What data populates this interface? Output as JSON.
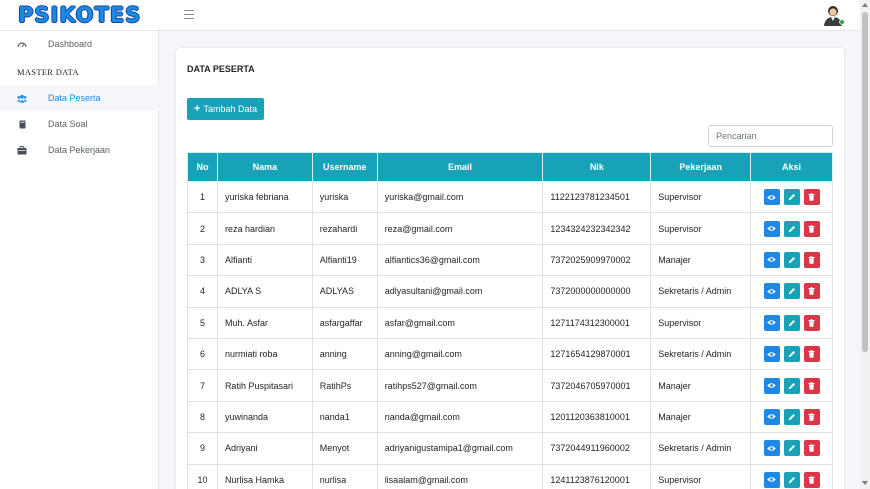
{
  "brand": "PSIKOTES",
  "sidebar": {
    "dashboard": "Dashboard",
    "section_header": "MASTER DATA",
    "items": [
      {
        "label": "Data Peserta",
        "icon": "users-icon",
        "active": true
      },
      {
        "label": "Data Soal",
        "icon": "book-icon",
        "active": false
      },
      {
        "label": "Data Pekerjaan",
        "icon": "briefcase-icon",
        "active": false
      }
    ]
  },
  "main": {
    "title": "DATA PESERTA",
    "add_button": "Tambah Data",
    "search_placeholder": "Pencarian",
    "columns": [
      "No",
      "Nama",
      "Username",
      "Email",
      "Nik",
      "Pekerjaan",
      "Aksi"
    ],
    "rows": [
      {
        "no": "1",
        "nama": "yuriska febriana",
        "username": "yuriska",
        "email": "yuriska@gmail.com",
        "nik": "1122123781234501",
        "pekerjaan": "Supervisor"
      },
      {
        "no": "2",
        "nama": "reza hardian",
        "username": "rezahardi",
        "email": "reza@gmail.com",
        "nik": "1234324232342342",
        "pekerjaan": "Supervisor"
      },
      {
        "no": "3",
        "nama": "Alfianti",
        "username": "Alfianti19",
        "email": "alfiantics36@gmail.com",
        "nik": "7372025909970002",
        "pekerjaan": "Manajer"
      },
      {
        "no": "4",
        "nama": "ADLYA S",
        "username": "ADLYAS",
        "email": "adlyasultani@gmail.com",
        "nik": "7372000000000000",
        "pekerjaan": "Sekretaris / Admin"
      },
      {
        "no": "5",
        "nama": "Muh. Asfar",
        "username": "asfargaffar",
        "email": "asfar@gmail.com",
        "nik": "1271174312300001",
        "pekerjaan": "Supervisor"
      },
      {
        "no": "6",
        "nama": "nurmiati roba",
        "username": "anning",
        "email": "anning@gmail.com",
        "nik": "1271654129870001",
        "pekerjaan": "Sekretaris / Admin"
      },
      {
        "no": "7",
        "nama": "Ratih Puspitasari",
        "username": "RatihPs",
        "email": "ratihps527@gmail.com",
        "nik": "7372046705970001",
        "pekerjaan": "Manajer"
      },
      {
        "no": "8",
        "nama": "yuwinanda",
        "username": "nanda1",
        "email": "nanda@gmail.com",
        "nik": "1201120363810001",
        "pekerjaan": "Manajer"
      },
      {
        "no": "9",
        "nama": "Adriyani",
        "username": "Menyot",
        "email": "adriyanigustamipa1@gmail.com",
        "nik": "7372044911960002",
        "pekerjaan": "Sekretaris / Admin"
      },
      {
        "no": "10",
        "nama": "Nurlisa Hamka",
        "username": "nurlisa",
        "email": "lisaalam@gmail.com",
        "nik": "1241123876120001",
        "pekerjaan": "Supervisor"
      }
    ]
  },
  "colors": {
    "accent": "#17a2b8",
    "primary": "#1e88e5",
    "danger": "#dc3545"
  }
}
